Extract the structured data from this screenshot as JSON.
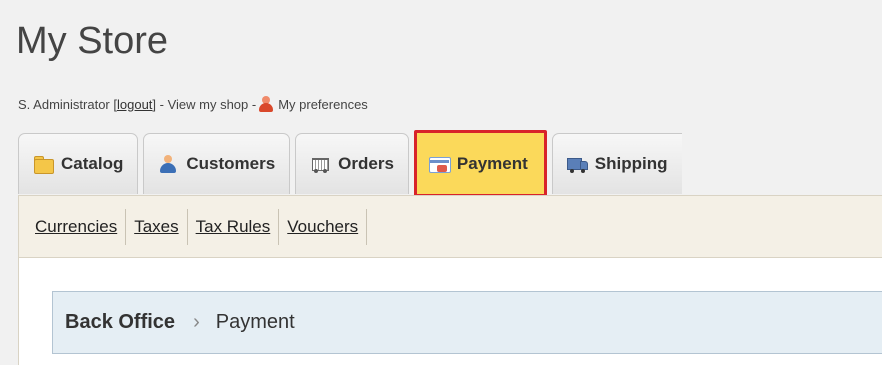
{
  "store": {
    "title": "My Store"
  },
  "admin_bar": {
    "user_text": "S. Administrator [ ",
    "logout_label": "logout",
    "after_logout": " ] - View my shop - ",
    "preferences_label": "My preferences"
  },
  "tabs": [
    {
      "label": "Catalog",
      "icon": "folder-icon"
    },
    {
      "label": "Customers",
      "icon": "customers-icon"
    },
    {
      "label": "Orders",
      "icon": "cart-icon"
    },
    {
      "label": "Payment",
      "icon": "credit-card-icon",
      "active": true
    },
    {
      "label": "Shipping",
      "icon": "truck-icon"
    }
  ],
  "subtabs": [
    "Currencies",
    "Taxes",
    "Tax Rules",
    "Vouchers"
  ],
  "breadcrumb": {
    "root": "Back Office",
    "separator": "›",
    "current": "Payment"
  },
  "colors": {
    "active_tab_bg": "#fbd95a",
    "active_tab_outline": "#d8232a",
    "breadcrumb_bg": "#e5eef4"
  }
}
